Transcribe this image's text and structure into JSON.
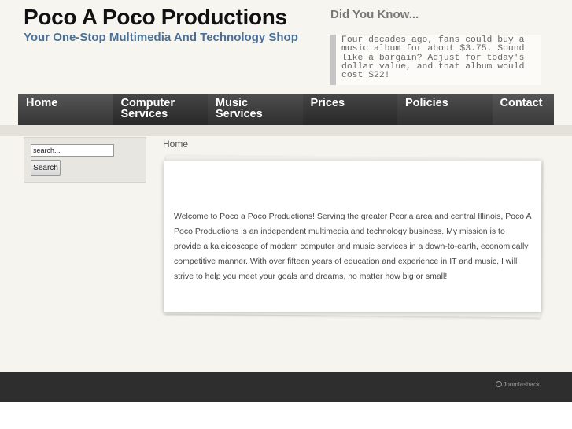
{
  "site": {
    "title": "Poco A Poco Productions",
    "tagline": "Your One-Stop Multimedia And Technology Shop"
  },
  "did_you_know": {
    "heading": "Did You Know...",
    "text": "Four decades ago, fans could buy a music album for about $3.75. Sound like a bargain? Adjust for today's dollar value, and that album would cost $22!"
  },
  "nav": {
    "items": [
      {
        "label": "Home"
      },
      {
        "label": "Computer Services"
      },
      {
        "label": "Music Services"
      },
      {
        "label": "Prices"
      },
      {
        "label": "Policies"
      },
      {
        "label": "Contact"
      }
    ]
  },
  "search": {
    "value": "search...",
    "button_label": "Search"
  },
  "breadcrumb": "Home",
  "content": {
    "body": "Welcome to Poco a Poco Productions! Serving the greater Peoria area and central Illinois, Poco A Poco Productions is an independent multimedia and technology business. My mission is to provide a kaleidoscope of modern computer and music services in a down-to-earth, economically competitive manner. With over fifteen years of education and experience in IT and music, I will strive to help you meet your goals and dreams, no matter how big or small!"
  },
  "footer": {
    "credit": "Joomlashack"
  },
  "colors": {
    "tagline": "#4a7098",
    "nav": "#3b3b3b",
    "footer": "#2e2e2e"
  }
}
